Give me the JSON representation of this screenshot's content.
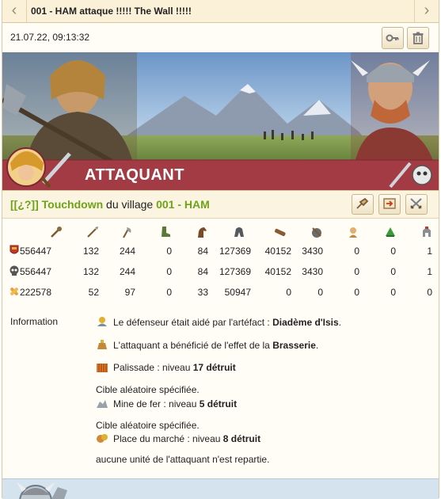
{
  "titlebar": {
    "title": "001 - HAM attaque !!!!! The Wall !!!!!",
    "prev_icon": "chevron-left-icon",
    "next_icon": "chevron-right-icon"
  },
  "report": {
    "date": "21.07.22, 09:13:32",
    "share_icon": "key-icon",
    "delete_icon": "trash-icon"
  },
  "banner": {
    "label": "ATTAQUANT"
  },
  "player": {
    "alliance": "[[¿?]]",
    "name": "Touchdown",
    "connector": " du village ",
    "village": "001 - HAM"
  },
  "troops": {
    "unit_icons": [
      "club-icon",
      "spear-icon",
      "axe-icon",
      "boot-scout-icon",
      "horse-icon",
      "helmet-knight-icon",
      "ram-icon",
      "catapult-icon",
      "chief-icon",
      "settler-icon",
      "hero-icon"
    ],
    "rows": [
      {
        "label_icon": "troops-icon",
        "values": [
          "556447",
          "132",
          "244",
          "0",
          "84",
          "127369",
          "40152",
          "3430",
          "0",
          "0",
          "1"
        ]
      },
      {
        "label_icon": "skull-icon",
        "values": [
          "556447",
          "132",
          "244",
          "0",
          "84",
          "127369",
          "40152",
          "3430",
          "0",
          "0",
          "1"
        ]
      },
      {
        "label_icon": "bandage-icon",
        "values": [
          "222578",
          "52",
          "97",
          "0",
          "33",
          "50947",
          "0",
          "0",
          "0",
          "0",
          "0"
        ]
      }
    ]
  },
  "info": {
    "label": "Information",
    "l1_pre": "Le défenseur était aidé par l'artéfact : ",
    "l1_bold": "Diadème d'Isis",
    "l1_post": ".",
    "l2_pre": "L'attaquant a bénéficié de l'effet de la ",
    "l2_bold": "Brasserie",
    "l2_post": ".",
    "l3_pre": "Palissade : niveau ",
    "l3_bold": "17 détruit",
    "l4": "Cible aléatoire spécifiée.",
    "l5_pre": "Mine de fer : niveau ",
    "l5_bold": "5 détruit",
    "l6": "Cible aléatoire spécifiée.",
    "l7_pre": "Place du marché : niveau ",
    "l7_bold": "8 détruit",
    "l8": "aucune unité de l'attaquant n'est repartie."
  }
}
